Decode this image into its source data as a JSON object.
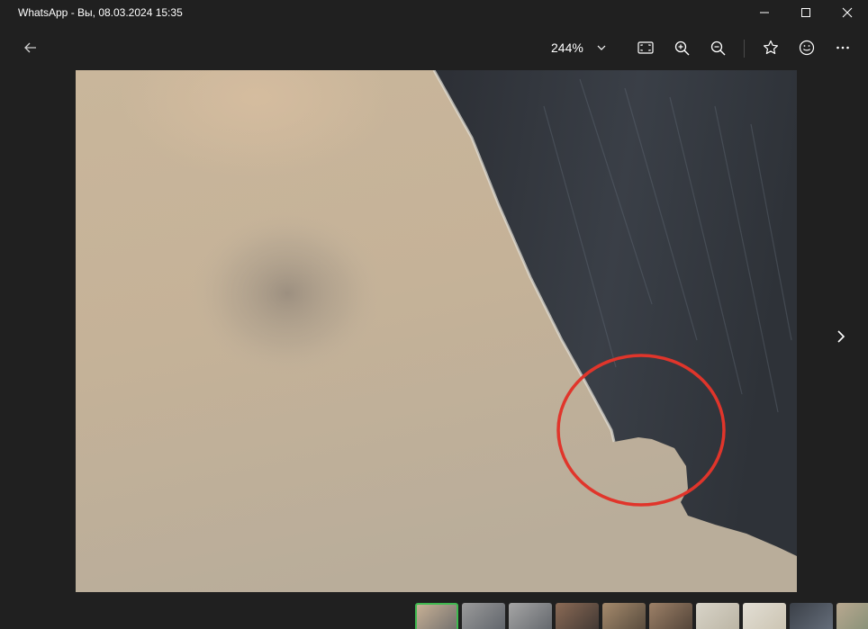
{
  "window": {
    "title": "WhatsApp - Вы, 08.03.2024 15:35",
    "minimize_icon": "minimize-icon",
    "maximize_icon": "maximize-icon",
    "close_icon": "close-icon"
  },
  "toolbar": {
    "back_icon": "arrow-left-icon",
    "zoom_level": "244%",
    "zoom_dropdown_icon": "chevron-down-icon",
    "fit_icon": "fit-to-window-icon",
    "zoom_in_icon": "zoom-in-icon",
    "zoom_out_icon": "zoom-out-icon",
    "favorite_icon": "star-icon",
    "feedback_icon": "smiley-icon",
    "more_icon": "more-horizontal-icon"
  },
  "viewer": {
    "next_icon": "chevron-right-icon"
  },
  "colors": {
    "background": "#202020",
    "annotation_circle": "#e0352b",
    "selected_thumb_border": "#3fb950"
  },
  "filmstrip": {
    "selected_index": 0,
    "thumb_count": 10
  }
}
